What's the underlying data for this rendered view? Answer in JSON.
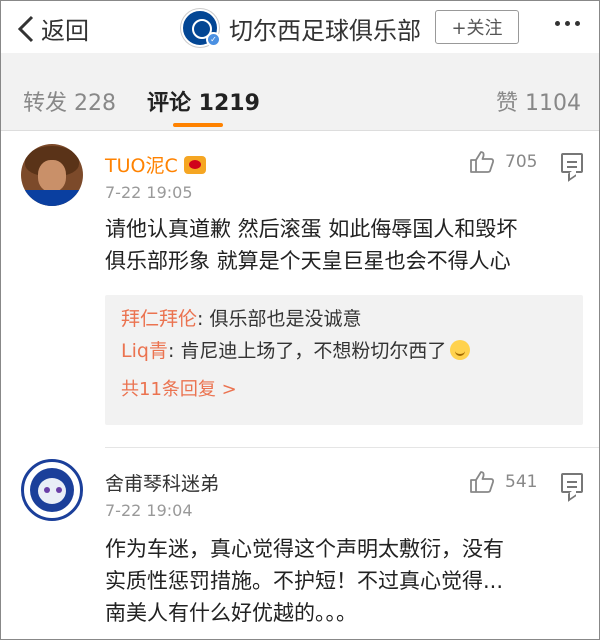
{
  "header": {
    "back_label": "返回",
    "title": "切尔西足球俱乐部",
    "follow_label": "+关注"
  },
  "tabs": [
    {
      "label": "转发 228"
    },
    {
      "label": "评论 1219"
    },
    {
      "label": "赞 1104"
    }
  ],
  "comments": [
    {
      "user": "TUO泥C",
      "time": "7-22 19:05",
      "likes": "705",
      "lines": [
        "请他认真道歉 然后滚蛋 如此侮辱国人和毁坏",
        "俱乐部形象 就算是个天皇巨星也会不得人心"
      ],
      "replies": [
        {
          "user": "拜仁拜伦",
          "text": ": 俱乐部也是没诚意"
        },
        {
          "user": "Liq青",
          "text": ": 肯尼迪上场了，不想粉切尔西了"
        }
      ],
      "more_replies": "共11条回复 >"
    },
    {
      "user": "舍甫琴科迷弟",
      "time": "7-22 19:04",
      "likes": "541",
      "lines": [
        "作为车迷，真心觉得这个声明太敷衍，没有",
        "实质性惩罚措施。不护短！不过真心觉得...",
        "南美人有什么好优越的。。。"
      ]
    }
  ],
  "colors": {
    "accent_orange": "#ff8200",
    "reply_name": "#eb7350",
    "chelsea_blue": "#034694"
  }
}
